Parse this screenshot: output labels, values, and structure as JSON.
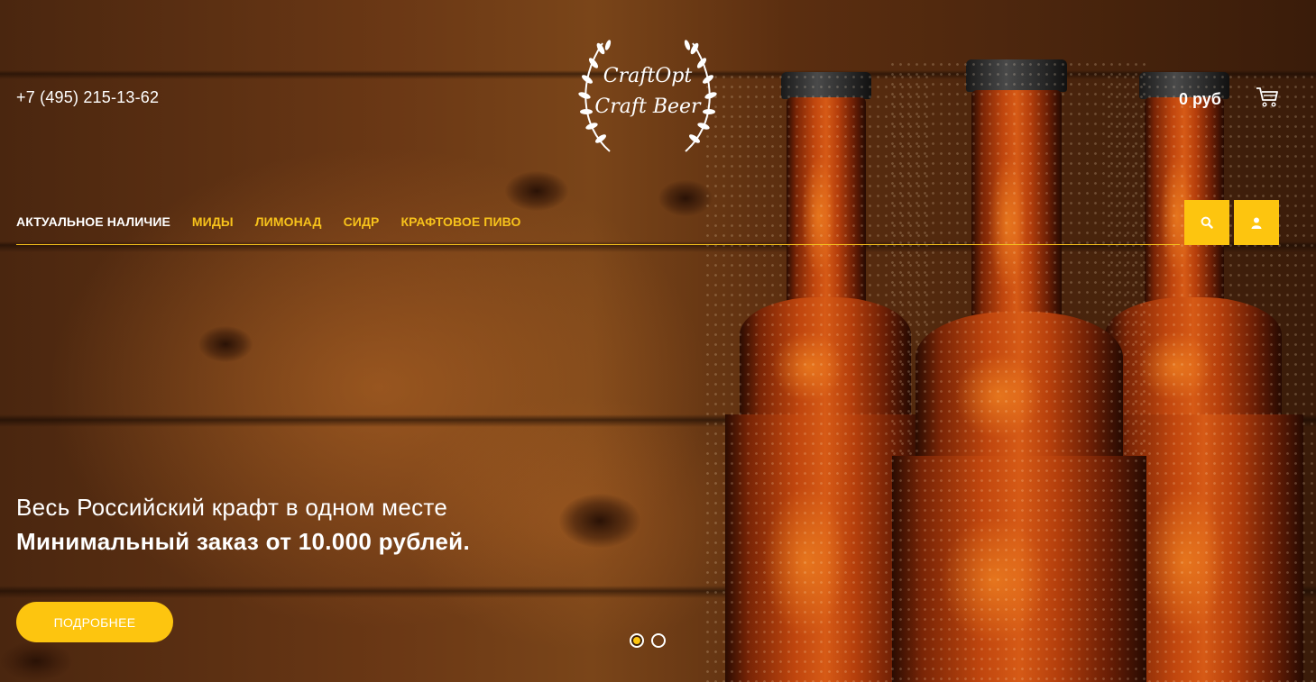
{
  "header": {
    "phone": "+7 (495) 215-13-62",
    "logo": {
      "line1": "CraftOpt",
      "line2": "Craft Beer"
    },
    "cart_total": "0 руб",
    "cart_icon": "cart-icon"
  },
  "nav": {
    "items": [
      {
        "label": "АКТУАЛЬНОЕ НАЛИЧИЕ",
        "active": true
      },
      {
        "label": "МИДЫ",
        "active": false
      },
      {
        "label": "ЛИМОНАД",
        "active": false
      },
      {
        "label": "СИДР",
        "active": false
      },
      {
        "label": "КРАФТОВОЕ ПИВО",
        "active": false
      }
    ],
    "search_icon": "search-icon",
    "user_icon": "user-icon"
  },
  "hero": {
    "line1": "Весь Российский крафт в одном месте",
    "line2": "Минимальный заказ от 10.000 рублей.",
    "button": "ПОДРОБНЕЕ"
  },
  "slider": {
    "slides": 2,
    "active": 1
  },
  "colors": {
    "accent": "#fdc50f",
    "nav_link": "#f7c21b",
    "text": "#ffffff"
  }
}
